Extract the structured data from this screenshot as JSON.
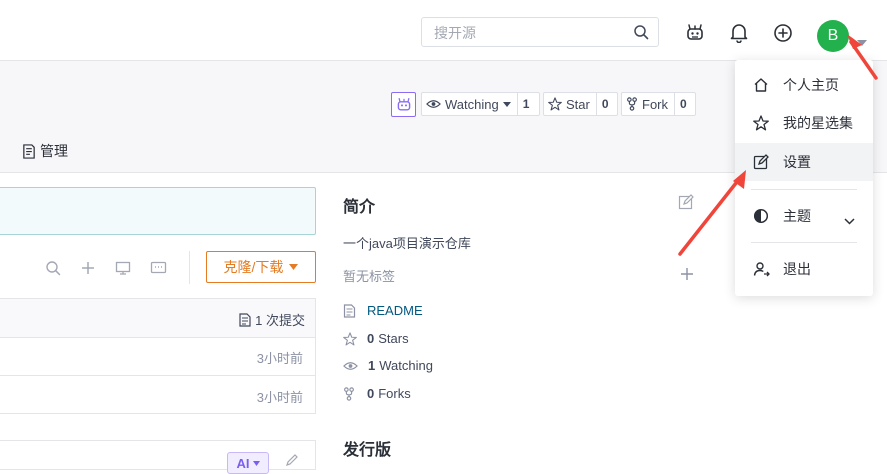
{
  "header": {
    "search_placeholder": "搜开源",
    "avatar_letter": "B"
  },
  "repo_actions": {
    "watching_label": "Watching",
    "watching_count": "1",
    "star_label": "Star",
    "star_count": "0",
    "fork_label": "Fork",
    "fork_count": "0"
  },
  "tabs": {
    "manage": "管理"
  },
  "clone_button": "克隆/下载",
  "commits": {
    "count_label": "1 次提交",
    "rows": [
      {
        "time": "3小时前"
      },
      {
        "time": "3小时前"
      }
    ]
  },
  "ai_badge": "AI",
  "sidebar": {
    "intro_title": "简介",
    "description": "一个java项目演示仓库",
    "no_tags": "暂无标签",
    "readme": "README",
    "stars_count": "0",
    "stars_label": "Stars",
    "watching_count": "1",
    "watching_label": "Watching",
    "forks_count": "0",
    "forks_label": "Forks",
    "releases_title": "发行版"
  },
  "user_menu": {
    "items": [
      {
        "label": "个人主页",
        "icon": "home-icon"
      },
      {
        "label": "我的星选集",
        "icon": "star-icon"
      },
      {
        "label": "设置",
        "icon": "edit-icon"
      },
      {
        "label": "主题",
        "icon": "theme-icon"
      },
      {
        "label": "退出",
        "icon": "logout-icon"
      }
    ]
  },
  "colors": {
    "avatar_green": "#22b14c",
    "clone_orange": "#e57b22",
    "link_blue": "#005980",
    "annotation_red": "#f0453a",
    "highlight_item": "#f2f3f5"
  }
}
